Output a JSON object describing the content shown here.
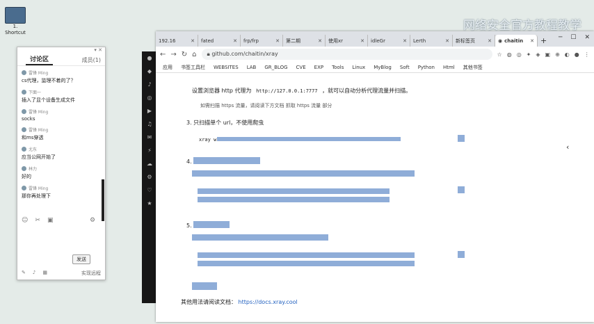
{
  "desktop": {
    "icon_label_1": "1.",
    "icon_label_2": "Shortcut",
    "watermark": "网络安全官方教程教学"
  },
  "chat": {
    "window_controls": "▾ ✕",
    "tab_discussion": "讨论区",
    "tab_members": "成员(1)",
    "messages": [
      {
        "user": "雷锋 Ming",
        "text": "cs代理，监理不着的了？"
      },
      {
        "user": "下面一",
        "text": "插入了显个设备生成文件"
      },
      {
        "user": "雷锋 Ming",
        "text": "socks"
      },
      {
        "user": "雷锋 Ming",
        "text": "和ms穿透"
      },
      {
        "user": "尤东",
        "text": "应当公网开始了"
      },
      {
        "user": "林力",
        "text": "好的"
      },
      {
        "user": "雷锋 Ming",
        "text": "那你再处理下"
      }
    ],
    "send_label": "发送",
    "footer_link": "实现远程"
  },
  "browser": {
    "tabs": [
      {
        "label": "192.16"
      },
      {
        "label": "fated"
      },
      {
        "label": "frp/frp"
      },
      {
        "label": "第二期"
      },
      {
        "label": "使用xr"
      },
      {
        "label": "idleGr"
      },
      {
        "label": "Lerth"
      },
      {
        "label": "新标签页"
      },
      {
        "label": "chaitin"
      }
    ],
    "new_tab": "+",
    "url": "github.com/chaitin/xray",
    "bookmarks": [
      "应用",
      "书签工具栏",
      "WEBSITES",
      "LAB",
      "GR_BLOG",
      "CVE",
      "EXP",
      "Tools",
      "Linux",
      "MyBlog",
      "Soft",
      "Python",
      "Html",
      "其他书签"
    ]
  },
  "doc": {
    "line1_a": "设置浏览器 http 代理为",
    "line1_code": "http://127.0.0.1:7777",
    "line1_b": "，就可以自动分析代理流量并扫描。",
    "line2": "如需扫描 https 流量，请阅读下方文档 抓取 https 流量 部分",
    "step3": "3. 只扫描单个 url，不使用爬虫",
    "step3_code": "xray w",
    "step4": "4.",
    "step5": "5.",
    "footer_a": "其他用法请阅读文档：",
    "footer_link": "https://docs.xray.cool"
  }
}
